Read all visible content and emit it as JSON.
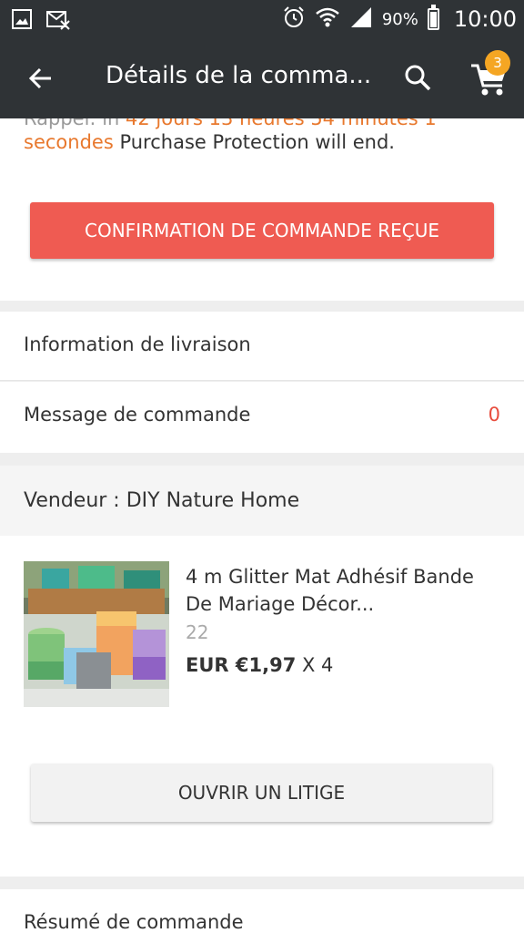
{
  "status_bar": {
    "battery_percent": "90%",
    "time": "10:00",
    "icons": [
      "gallery-icon",
      "mail-off-icon",
      "alarm-icon",
      "wifi-icon",
      "signal-icon",
      "battery-icon"
    ]
  },
  "app_bar": {
    "title": "Détails de la comma...",
    "cart_count": "3",
    "icons": [
      "back-arrow-icon",
      "search-icon",
      "cart-icon"
    ]
  },
  "protection": {
    "clipped_prefix": "Rappel:",
    "clipped_in": "in",
    "clipped_time": "42 jours 13 heures 54 minutes 1",
    "seconds_word": "secondes",
    "suffix": " Purchase Protection will end."
  },
  "confirm_button_label": "CONFIRMATION DE COMMANDE REÇUE",
  "delivery_label": "Information de livraison",
  "message": {
    "label": "Message de commande",
    "count": "0"
  },
  "seller_label": "Vendeur : DIY Nature Home",
  "product": {
    "title": "4 m Glitter Mat Adhésif Bande De Mariage Décor...",
    "sku": "22",
    "price": "EUR €1,97",
    "quantity": " X 4"
  },
  "dispute_button_label": "OUVRIR UN LITIGE",
  "summary_label": "Résumé de commande",
  "colors": {
    "header_bg": "#2f3336",
    "confirm_button": "#ef5b52",
    "badge": "#f5a623",
    "accent_orange": "#e8782d",
    "count_red": "#e84c3d"
  }
}
